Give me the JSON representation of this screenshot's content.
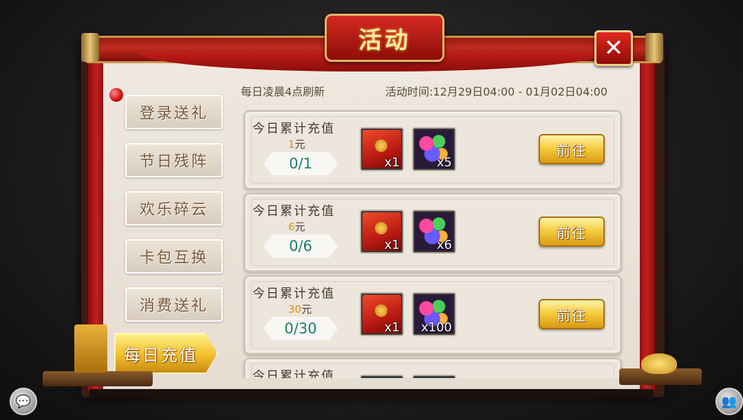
{
  "title": "活动",
  "close_symbol": "✕",
  "header": {
    "refresh_note": "每日凌晨4点刷新",
    "activity_time": "活动时间:12月29日04:00 - 01月02日04:00"
  },
  "sidebar": {
    "tabs": [
      {
        "label": "登录送礼"
      },
      {
        "label": "节日残阵"
      },
      {
        "label": "欢乐碎云"
      },
      {
        "label": "卡包互换"
      },
      {
        "label": "消费送礼"
      },
      {
        "label": "每日充值",
        "active": true
      }
    ]
  },
  "rewards": [
    {
      "title": "今日累计充值",
      "amount": "1",
      "unit": "元",
      "progress": "0/1",
      "items": [
        {
          "icon": "red-envelope-icon",
          "count": "x1"
        },
        {
          "icon": "gems-icon",
          "count": "x5"
        }
      ],
      "button": "前往"
    },
    {
      "title": "今日累计充值",
      "amount": "6",
      "unit": "元",
      "progress": "0/6",
      "items": [
        {
          "icon": "red-envelope-icon",
          "count": "x1"
        },
        {
          "icon": "gems-icon",
          "count": "x6"
        }
      ],
      "button": "前往"
    },
    {
      "title": "今日累计充值",
      "amount": "30",
      "unit": "元",
      "progress": "0/30",
      "items": [
        {
          "icon": "red-envelope-icon",
          "count": "x1"
        },
        {
          "icon": "gems-icon",
          "count": "x100"
        }
      ],
      "button": "前往"
    },
    {
      "title": "今日累计充值"
    }
  ],
  "icons": {
    "chat": "chat-icon",
    "social": "friends-icon"
  },
  "colors": {
    "accent_gold": "#f1c02a",
    "frame_red": "#c42020",
    "progress_teal": "#1e7a6a",
    "amount_orange": "#e38b1a"
  }
}
